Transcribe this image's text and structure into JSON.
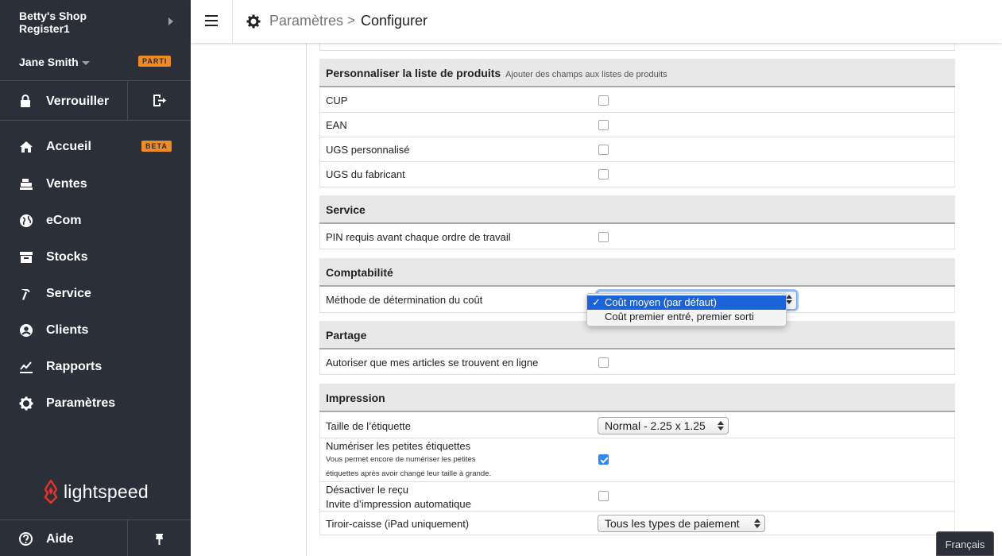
{
  "sidebar": {
    "shop_name": "Betty's Shop",
    "register": "Register1",
    "user_name": "Jane Smith",
    "user_badge": "PARTI",
    "lock_label": "Verrouiller",
    "nav": [
      {
        "label": "Accueil",
        "icon": "home-icon",
        "badge": "BETA"
      },
      {
        "label": "Ventes",
        "icon": "register-icon"
      },
      {
        "label": "eCom",
        "icon": "globe-icon"
      },
      {
        "label": "Stocks",
        "icon": "inventory-icon"
      },
      {
        "label": "Service",
        "icon": "hammer-icon"
      },
      {
        "label": "Clients",
        "icon": "customer-icon"
      },
      {
        "label": "Rapports",
        "icon": "chart-icon"
      },
      {
        "label": "Paramètres",
        "icon": "gear-icon"
      }
    ],
    "logo_text": "lightspeed",
    "help_label": "Aide"
  },
  "header": {
    "breadcrumb_parent": "Paramètres",
    "breadcrumb_separator": ">",
    "breadcrumb_current": "Configurer"
  },
  "sections": {
    "products": {
      "title": "Personnaliser la liste de produits",
      "subtitle": "Ajouter des champs aux listes de produits",
      "rows": [
        {
          "label": "CUP",
          "checked": false
        },
        {
          "label": "EAN",
          "checked": false
        },
        {
          "label": "UGS personnalisé",
          "checked": false
        },
        {
          "label": "UGS du fabricant",
          "checked": false
        }
      ]
    },
    "service": {
      "title": "Service",
      "rows": [
        {
          "label": "PIN requis avant chaque ordre de travail",
          "checked": false
        }
      ]
    },
    "accounting": {
      "title": "Comptabilité",
      "cost_label": "Méthode de détermination du coût",
      "cost_options": [
        "Coût moyen (par défaut)",
        "Coût premier entré, premier sorti"
      ],
      "cost_selected": "Coût moyen (par défaut)",
      "check_mark": "✓"
    },
    "sharing": {
      "title": "Partage",
      "rows": [
        {
          "label": "Autoriser que mes articles se trouvent en ligne",
          "checked": false
        }
      ]
    },
    "printing": {
      "title": "Impression",
      "label_size_label": "Taille de l’étiquette",
      "label_size_value": "Normal - 2.25 x 1.25",
      "scan_small_label": "Numériser les petites étiquettes",
      "scan_small_desc_1": "Vous permet encore de numériser les petites",
      "scan_small_desc_2": "étiquettes après avoir changé leur taille à grande.",
      "scan_small_checked": true,
      "disable_receipt_label_1": "Désactiver le reçu",
      "disable_receipt_label_2": "Invite d’impression automatique",
      "disable_receipt_checked": false,
      "drawer_label": "Tiroir-caisse (iPad uniquement)",
      "drawer_value": "Tous les types de paiement"
    }
  },
  "language_button": "Français",
  "colors": {
    "sidebar_bg": "#2b2f38",
    "badge": "#f08a24",
    "accent_blue": "#2d89f0",
    "logo_red": "#e2322d"
  }
}
